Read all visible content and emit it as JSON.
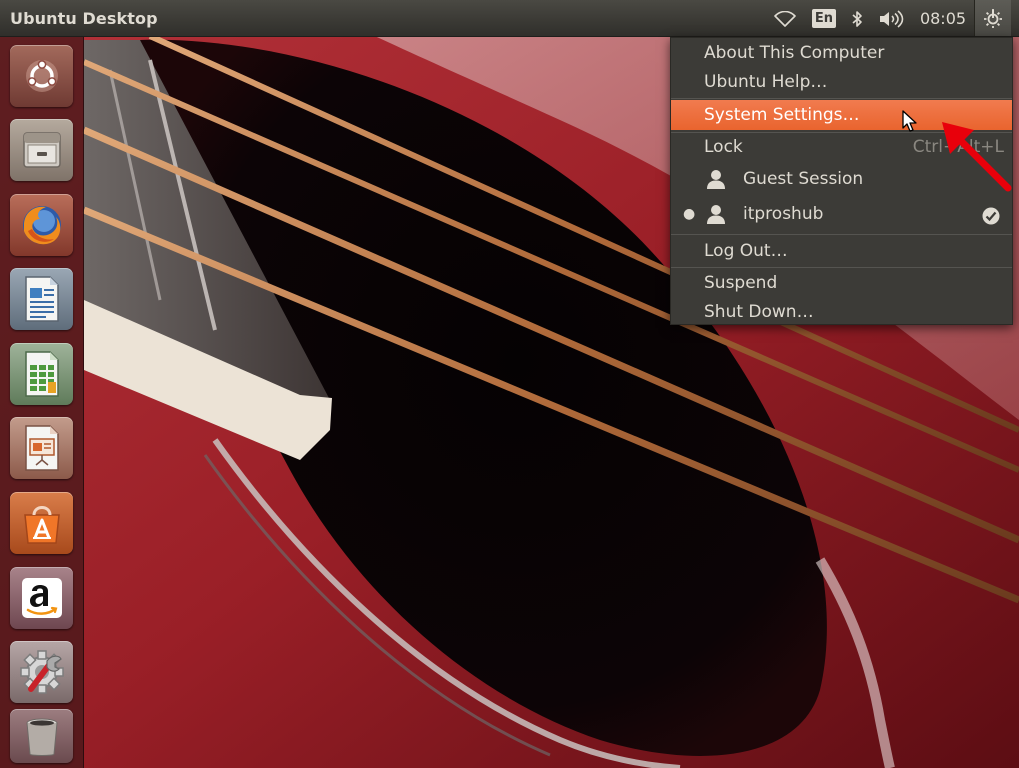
{
  "panel": {
    "title": "Ubuntu Desktop",
    "language": "En",
    "clock": "08:05",
    "indicators": [
      "wifi-icon",
      "bluetooth-icon",
      "volume-icon",
      "system-gear-icon"
    ]
  },
  "launcher": {
    "items": [
      {
        "name": "dash-home-icon"
      },
      {
        "name": "files-icon"
      },
      {
        "name": "firefox-icon"
      },
      {
        "name": "libreoffice-writer-icon"
      },
      {
        "name": "libreoffice-calc-icon"
      },
      {
        "name": "libreoffice-impress-icon"
      },
      {
        "name": "software-center-icon"
      },
      {
        "name": "amazon-icon"
      },
      {
        "name": "system-settings-icon"
      },
      {
        "name": "trash-icon"
      }
    ]
  },
  "menu": {
    "about": "About This Computer",
    "help": "Ubuntu Help…",
    "settings": "System Settings…",
    "lock": "Lock",
    "lock_shortcut": "Ctrl+Alt+L",
    "guest": "Guest Session",
    "user": "itproshub",
    "logout": "Log Out…",
    "suspend": "Suspend",
    "shutdown": "Shut Down…"
  },
  "colors": {
    "highlight": "#e9642e",
    "menu_bg": "#3c3b37",
    "panel_bg": "#3a3934",
    "annotation_arrow": "#e8000b"
  }
}
